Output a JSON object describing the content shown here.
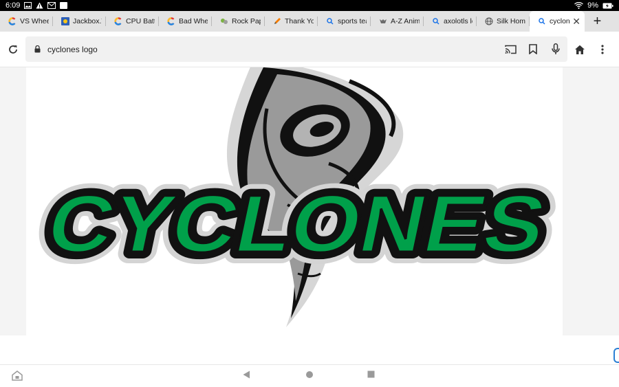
{
  "status_bar": {
    "time": "6:09",
    "battery": "9%",
    "icons": [
      "image-icon",
      "warning-icon",
      "gmail-icon",
      "blank-notification-icon",
      "wifi-icon",
      "battery-charging-icon"
    ]
  },
  "tabs": [
    {
      "label": "VS Wheel",
      "icon": "colorful-c-icon"
    },
    {
      "label": "Jackbox.TV",
      "icon": "jackbox-icon"
    },
    {
      "label": "CPU Battle",
      "icon": "colorful-c-icon"
    },
    {
      "label": "Bad Wheel",
      "icon": "colorful-c-icon"
    },
    {
      "label": "Rock Paper",
      "icon": "rock-paper-icon"
    },
    {
      "label": "Thank You!",
      "icon": "pencil-icon"
    },
    {
      "label": "sports team",
      "icon": "search-icon"
    },
    {
      "label": "A-Z Animal",
      "icon": "animal-icon"
    },
    {
      "label": "axolotls logo",
      "icon": "search-icon"
    },
    {
      "label": "Silk Home",
      "icon": "globe-icon"
    },
    {
      "label": "cyclones",
      "icon": "search-icon",
      "active": true
    }
  ],
  "new_tab_label": "+",
  "toolbar": {
    "url": "cyclones logo"
  },
  "logo": {
    "text": "CYCLONES",
    "colors": {
      "green": "#00a04a",
      "black": "#111111",
      "gray": "#9a9a9a",
      "light_gray": "#d4d4d4"
    }
  },
  "colors": {
    "tab_strip": "#e3e3e3",
    "omnibox": "#f1f1f1",
    "content_bg": "#f4f4f4"
  }
}
